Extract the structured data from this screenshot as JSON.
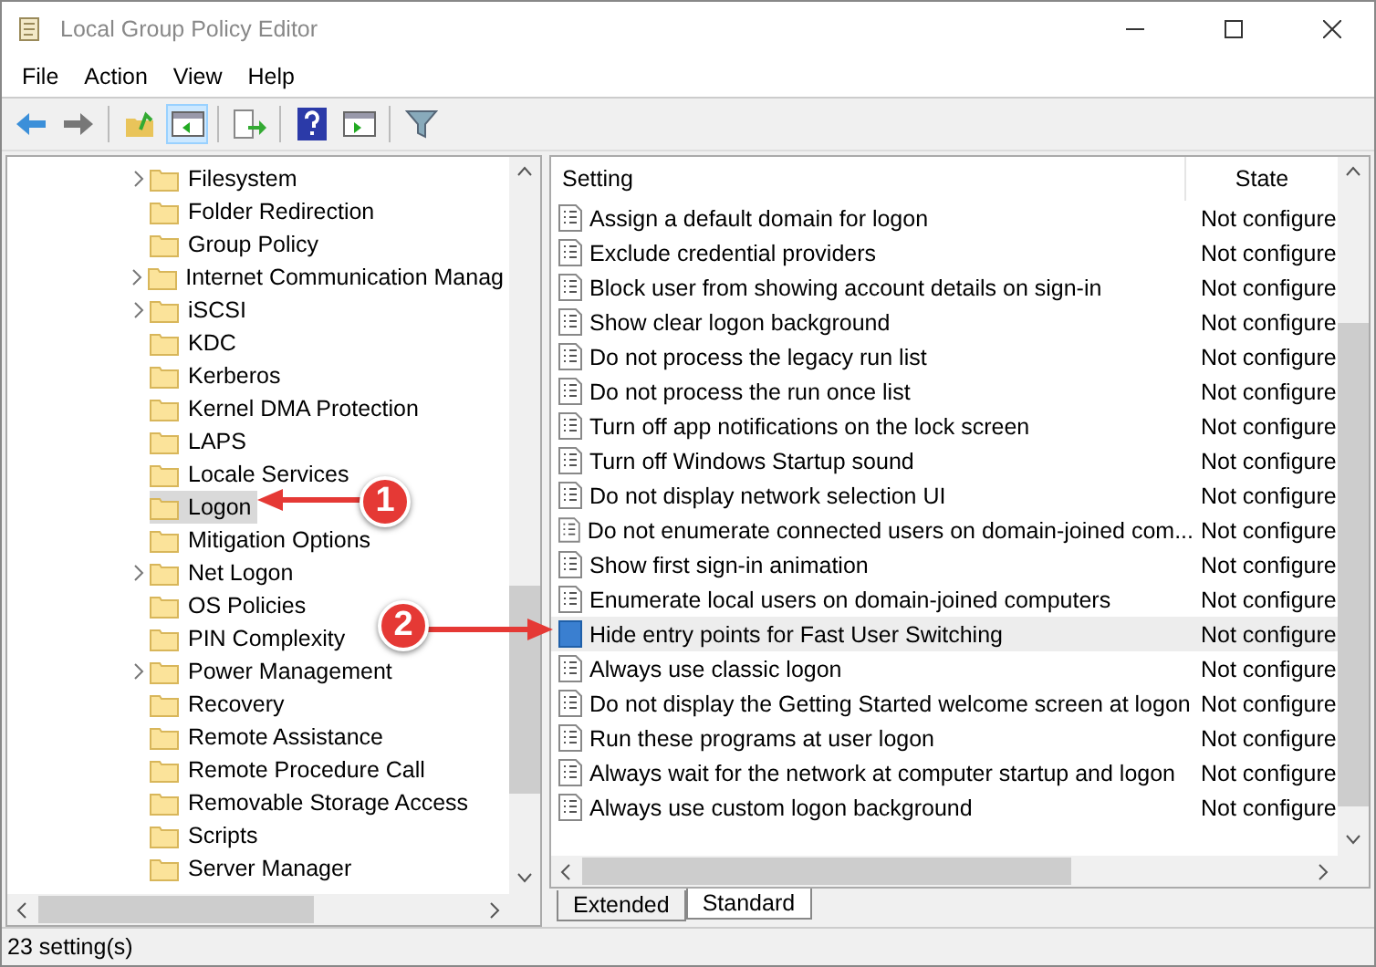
{
  "window": {
    "title": "Local Group Policy Editor"
  },
  "menu": [
    "File",
    "Action",
    "View",
    "Help"
  ],
  "tree": [
    {
      "label": "Filesystem",
      "expandable": true,
      "selected": false
    },
    {
      "label": "Folder Redirection",
      "expandable": false,
      "selected": false
    },
    {
      "label": "Group Policy",
      "expandable": false,
      "selected": false
    },
    {
      "label": "Internet Communication Manag",
      "expandable": true,
      "selected": false
    },
    {
      "label": "iSCSI",
      "expandable": true,
      "selected": false
    },
    {
      "label": "KDC",
      "expandable": false,
      "selected": false
    },
    {
      "label": "Kerberos",
      "expandable": false,
      "selected": false
    },
    {
      "label": "Kernel DMA Protection",
      "expandable": false,
      "selected": false
    },
    {
      "label": "LAPS",
      "expandable": false,
      "selected": false
    },
    {
      "label": "Locale Services",
      "expandable": false,
      "selected": false
    },
    {
      "label": "Logon",
      "expandable": false,
      "selected": true
    },
    {
      "label": "Mitigation Options",
      "expandable": false,
      "selected": false
    },
    {
      "label": "Net Logon",
      "expandable": true,
      "selected": false
    },
    {
      "label": "OS Policies",
      "expandable": false,
      "selected": false
    },
    {
      "label": "PIN Complexity",
      "expandable": false,
      "selected": false
    },
    {
      "label": "Power Management",
      "expandable": true,
      "selected": false
    },
    {
      "label": "Recovery",
      "expandable": false,
      "selected": false
    },
    {
      "label": "Remote Assistance",
      "expandable": false,
      "selected": false
    },
    {
      "label": "Remote Procedure Call",
      "expandable": false,
      "selected": false
    },
    {
      "label": "Removable Storage Access",
      "expandable": false,
      "selected": false
    },
    {
      "label": "Scripts",
      "expandable": false,
      "selected": false
    },
    {
      "label": "Server Manager",
      "expandable": false,
      "selected": false
    }
  ],
  "table": {
    "columns": [
      "Setting",
      "State"
    ],
    "rows": [
      {
        "setting": "Assign a default domain for logon",
        "state": "Not configure",
        "selected": false
      },
      {
        "setting": "Exclude credential providers",
        "state": "Not configure",
        "selected": false
      },
      {
        "setting": "Block user from showing account details on sign-in",
        "state": "Not configure",
        "selected": false
      },
      {
        "setting": "Show clear logon background",
        "state": "Not configure",
        "selected": false
      },
      {
        "setting": "Do not process the legacy run list",
        "state": "Not configure",
        "selected": false
      },
      {
        "setting": "Do not process the run once list",
        "state": "Not configure",
        "selected": false
      },
      {
        "setting": "Turn off app notifications on the lock screen",
        "state": "Not configure",
        "selected": false
      },
      {
        "setting": "Turn off Windows Startup sound",
        "state": "Not configure",
        "selected": false
      },
      {
        "setting": "Do not display network selection UI",
        "state": "Not configure",
        "selected": false
      },
      {
        "setting": "Do not enumerate connected users on domain-joined com...",
        "state": "Not configure",
        "selected": false
      },
      {
        "setting": "Show first sign-in animation",
        "state": "Not configure",
        "selected": false
      },
      {
        "setting": "Enumerate local users on domain-joined computers",
        "state": "Not configure",
        "selected": false
      },
      {
        "setting": "Hide entry points for Fast User Switching",
        "state": "Not configure",
        "selected": true
      },
      {
        "setting": "Always use classic logon",
        "state": "Not configure",
        "selected": false
      },
      {
        "setting": "Do not display the Getting Started welcome screen at logon",
        "state": "Not configure",
        "selected": false
      },
      {
        "setting": "Run these programs at user logon",
        "state": "Not configure",
        "selected": false
      },
      {
        "setting": "Always wait for the network at computer startup and logon",
        "state": "Not configure",
        "selected": false
      },
      {
        "setting": "Always use custom logon background",
        "state": "Not configure",
        "selected": false
      }
    ]
  },
  "tabs": [
    {
      "label": "Extended",
      "selected": false
    },
    {
      "label": "Standard",
      "selected": true
    }
  ],
  "status_bar": "23 setting(s)",
  "annotations": [
    {
      "label": "1"
    },
    {
      "label": "2"
    }
  ]
}
